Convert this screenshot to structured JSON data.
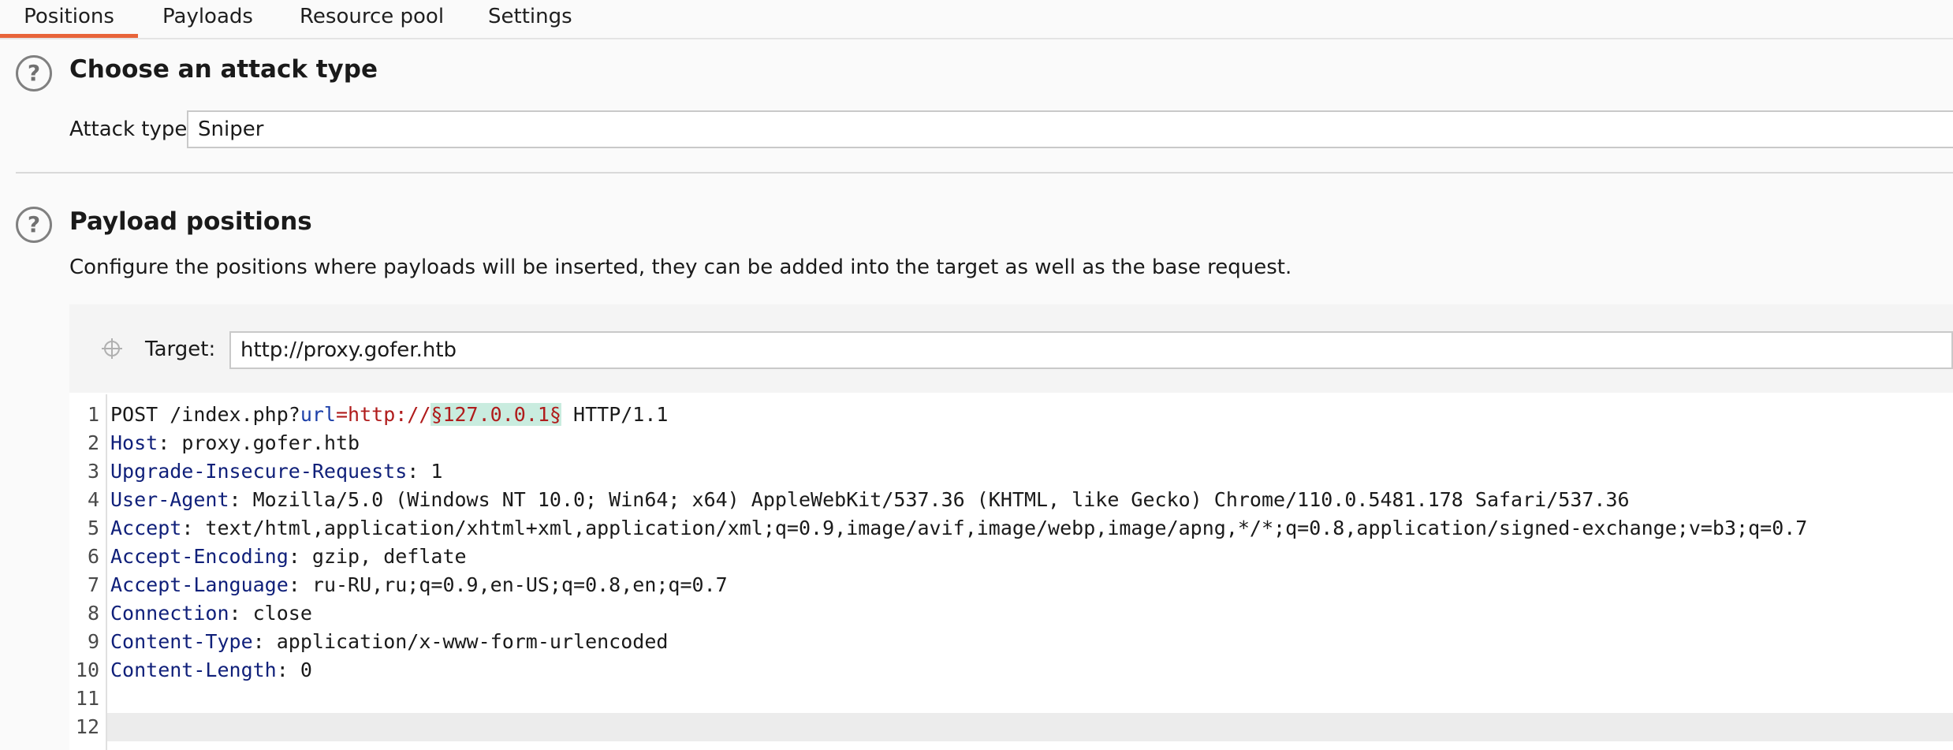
{
  "tabs": [
    {
      "label": "Positions",
      "active": true
    },
    {
      "label": "Payloads",
      "active": false
    },
    {
      "label": "Resource pool",
      "active": false
    },
    {
      "label": "Settings",
      "active": false
    }
  ],
  "attack_type_section": {
    "help_icon": "help-circle-icon",
    "help_glyph": "?",
    "title": "Choose an attack type",
    "attack_type_label": "Attack type:",
    "attack_type_value": "Sniper"
  },
  "payload_positions_section": {
    "help_icon": "help-circle-icon",
    "help_glyph": "?",
    "title": "Payload positions",
    "description": "Configure the positions where payloads will be inserted, they can be added into the target as well as the base request.",
    "target_icon": "crosshair-icon",
    "target_label": "Target:",
    "target_value": "http://proxy.gofer.htb"
  },
  "request": {
    "line_numbers": [
      "1",
      "2",
      "3",
      "4",
      "5",
      "6",
      "7",
      "8",
      "9",
      "10",
      "11",
      "12"
    ],
    "line1": {
      "method_path": "POST /index.php?",
      "param_name": "url",
      "equals": "=",
      "scheme": "http://",
      "marked_payload": "§127.0.0.1§",
      "protocol": " HTTP/1.1"
    },
    "headers": [
      {
        "name": "Host",
        "value": "proxy.gofer.htb"
      },
      {
        "name": "Upgrade-Insecure-Requests",
        "value": "1"
      },
      {
        "name": "User-Agent",
        "value": "Mozilla/5.0 (Windows NT 10.0; Win64; x64) AppleWebKit/537.36 (KHTML, like Gecko) Chrome/110.0.5481.178 Safari/537.36"
      },
      {
        "name": "Accept",
        "value": "text/html,application/xhtml+xml,application/xml;q=0.9,image/avif,image/webp,image/apng,*/*;q=0.8,application/signed-exchange;v=b3;q=0.7"
      },
      {
        "name": "Accept-Encoding",
        "value": "gzip, deflate"
      },
      {
        "name": "Accept-Language",
        "value": "ru-RU,ru;q=0.9,en-US;q=0.8,en;q=0.7"
      },
      {
        "name": "Connection",
        "value": "close"
      },
      {
        "name": "Content-Type",
        "value": "application/x-www-form-urlencoded"
      },
      {
        "name": "Content-Length",
        "value": "0"
      }
    ],
    "header_separator": ": "
  },
  "colors": {
    "active_tab_underline": "#e8643a",
    "header_name": "#10207a",
    "payload_marker_bg": "#c9ecdf",
    "url_red": "#b01c1c"
  }
}
